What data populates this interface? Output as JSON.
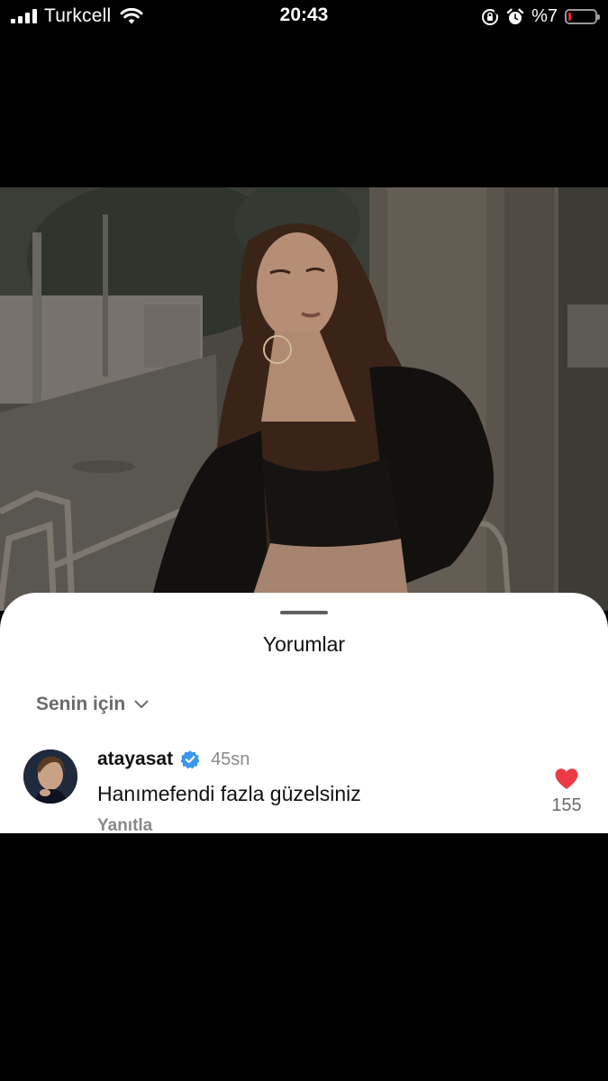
{
  "status_bar": {
    "carrier": "Turkcell",
    "time": "20:43",
    "battery_percent": "%7",
    "battery_level": 0.07,
    "icons": [
      "signal-icon",
      "wifi-icon",
      "orientation-lock-icon",
      "alarm-icon",
      "battery-icon"
    ]
  },
  "post": {
    "media": "photo"
  },
  "comments_sheet": {
    "title": "Yorumlar",
    "filter_label": "Senin için",
    "comment": {
      "username": "atayasat",
      "verified": true,
      "time_ago": "45sn",
      "text": "Hanımefendi fazla güzelsiniz",
      "reply_label": "Yanıtla",
      "like_count": "155",
      "liked": true
    }
  },
  "colors": {
    "like_red": "#ed3b45",
    "verified_blue": "#3897f0",
    "battery_low": "#e0262b"
  }
}
